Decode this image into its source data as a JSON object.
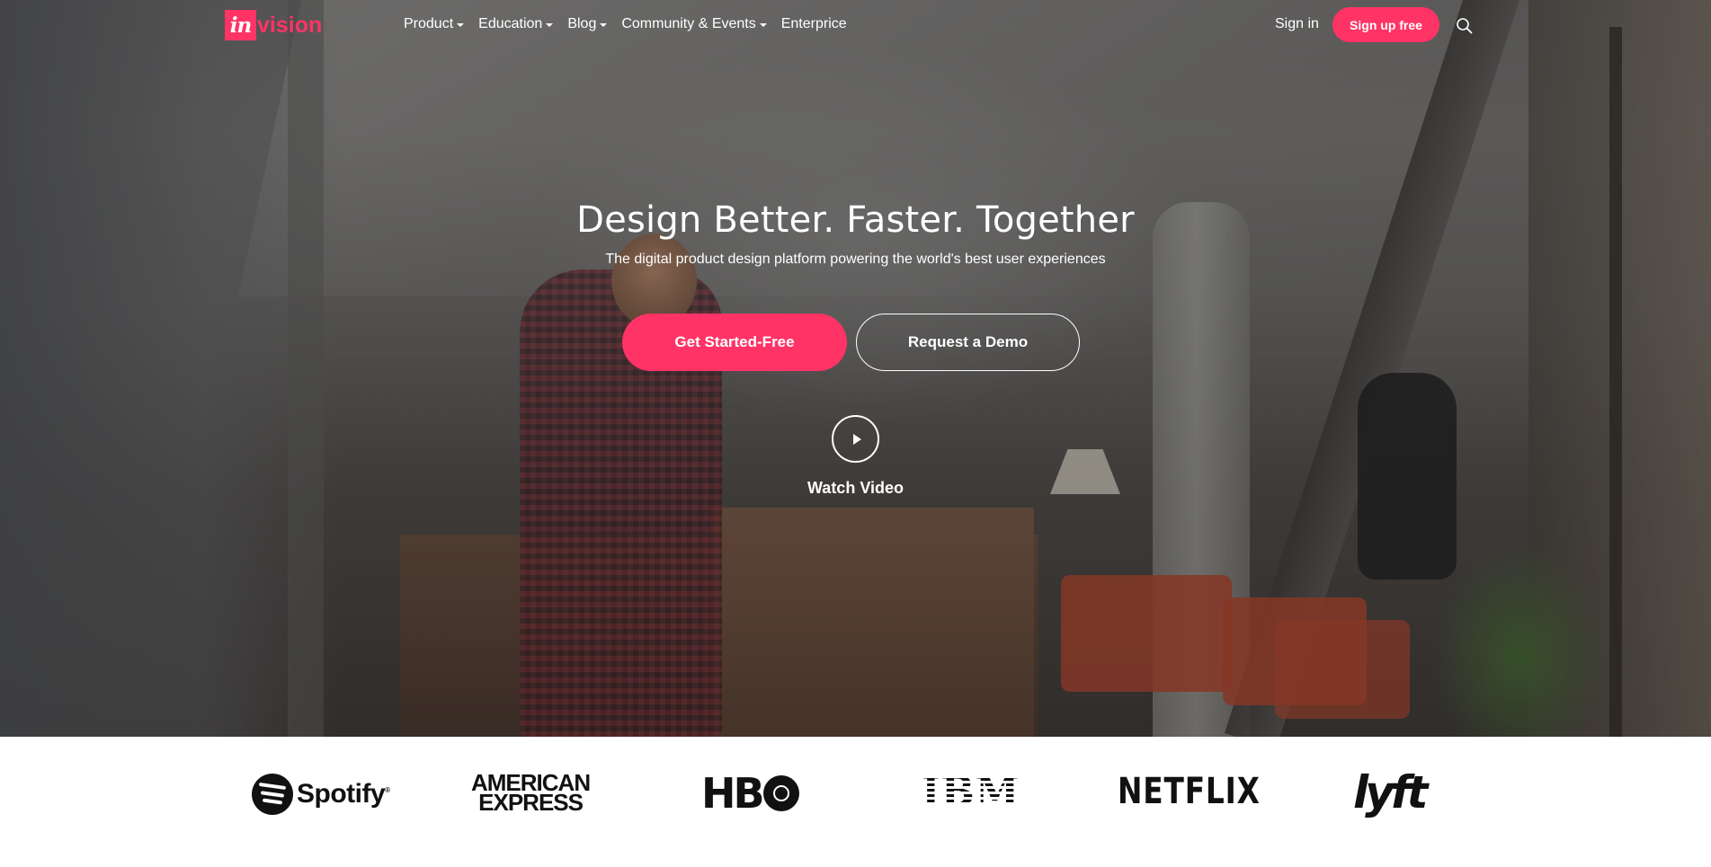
{
  "header": {
    "logo": {
      "mark": "in",
      "text": "vision"
    },
    "nav": [
      {
        "label": "Product",
        "dropdown": true
      },
      {
        "label": "Education",
        "dropdown": true
      },
      {
        "label": "Blog",
        "dropdown": true
      },
      {
        "label": "Community & Events",
        "dropdown": true
      },
      {
        "label": "Enterprice",
        "dropdown": false
      }
    ],
    "signin_label": "Sign in",
    "signup_label": "Sign up free",
    "search_icon": "search-icon"
  },
  "hero": {
    "title": "Design Better. Faster. Together",
    "subtitle": "The digital product design platform powering the world's best user experiences",
    "primary_cta": "Get Started-Free",
    "secondary_cta": "Request a Demo",
    "video_label": "Watch Video",
    "video_icon": "play-icon"
  },
  "logos": {
    "spotify": "Spotify",
    "spotify_mark": "®",
    "amex_line1": "AMERICAN",
    "amex_line2": "EXPRESS",
    "hbo": "HB",
    "ibm": "IBM",
    "netflix": "NETFLIX",
    "lyft": "lyft"
  },
  "colors": {
    "accent": "#ff3366",
    "text_on_hero": "#ffffff",
    "logo_ink": "#111111"
  }
}
